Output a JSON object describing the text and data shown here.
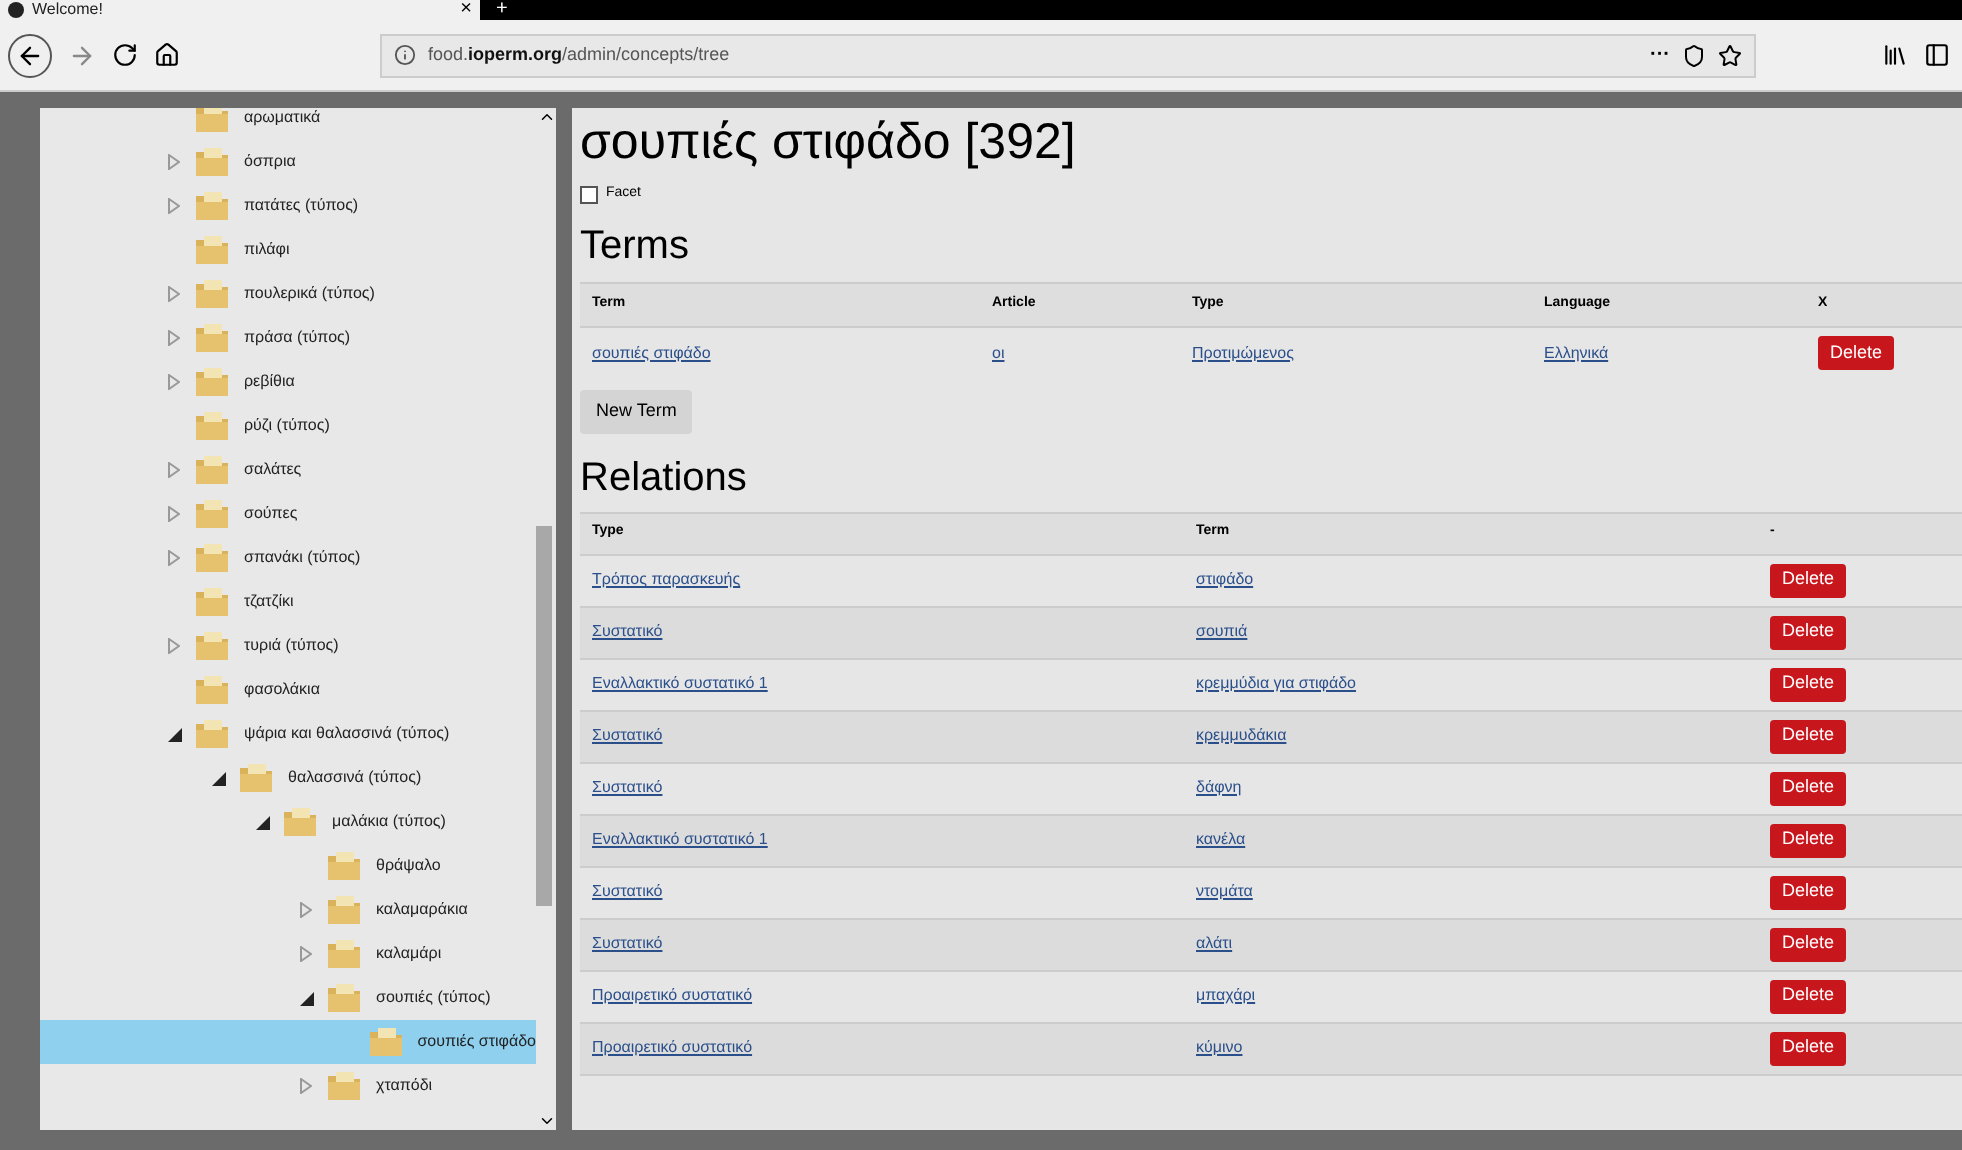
{
  "browser": {
    "tab_title": "Welcome!",
    "tab_close": "×",
    "new_tab": "+",
    "url_prefix": "food.",
    "url_domain": "ioperm.org",
    "url_path": "/admin/concepts/tree",
    "page_actions": "···"
  },
  "tree": [
    {
      "label": "αρωματικά",
      "kind": "leaf",
      "selected": false
    },
    {
      "label": "όσπρια",
      "kind": "collapsed",
      "selected": false
    },
    {
      "label": "πατάτες (τύπος)",
      "kind": "collapsed",
      "selected": false
    },
    {
      "label": "πιλάφι",
      "kind": "leaf",
      "selected": false
    },
    {
      "label": "πουλερικά (τύπος)",
      "kind": "collapsed",
      "selected": false
    },
    {
      "label": "πράσα (τύπος)",
      "kind": "collapsed",
      "selected": false
    },
    {
      "label": "ρεβίθια",
      "kind": "collapsed",
      "selected": false
    },
    {
      "label": "ρύζι (τύπος)",
      "kind": "leaf",
      "selected": false
    },
    {
      "label": "σαλάτες",
      "kind": "collapsed",
      "selected": false
    },
    {
      "label": "σούπες",
      "kind": "collapsed",
      "selected": false
    },
    {
      "label": "σπανάκι (τύπος)",
      "kind": "collapsed",
      "selected": false
    },
    {
      "label": "τζατζίκι",
      "kind": "leaf",
      "selected": false
    },
    {
      "label": "τυριά (τύπος)",
      "kind": "collapsed",
      "selected": false
    },
    {
      "label": "φασολάκια",
      "kind": "leaf",
      "selected": false
    },
    {
      "label": "ψάρια και θαλασσινά (τύπος)",
      "kind": "expanded",
      "selected": false,
      "children": [
        {
          "label": "θαλασσινά (τύπος)",
          "kind": "expanded",
          "selected": false,
          "children": [
            {
              "label": "μαλάκια (τύπος)",
              "kind": "expanded",
              "selected": false,
              "children": [
                {
                  "label": "θράψαλο",
                  "kind": "leaf",
                  "selected": false
                },
                {
                  "label": "καλαμαράκια",
                  "kind": "collapsed",
                  "selected": false
                },
                {
                  "label": "καλαμάρι",
                  "kind": "collapsed",
                  "selected": false
                },
                {
                  "label": "σουπιές (τύπος)",
                  "kind": "expanded",
                  "selected": false,
                  "children": [
                    {
                      "label": "σουπιές στιφάδο",
                      "kind": "leaf",
                      "selected": true
                    }
                  ]
                },
                {
                  "label": "χταπόδι",
                  "kind": "collapsed",
                  "selected": false
                }
              ]
            }
          ]
        }
      ]
    }
  ],
  "concept": {
    "title": "σουπιές στιφάδο [392]",
    "facet": {
      "label": "Facet",
      "checked": false
    }
  },
  "terms": {
    "heading": "Terms",
    "columns": [
      "Term",
      "Article",
      "Type",
      "Language",
      "X"
    ],
    "rows": [
      {
        "term": "σουπιές στιφάδο",
        "article": "οι",
        "type": "Προτιμώμενος",
        "language": "Ελληνικά",
        "action": "Delete"
      }
    ],
    "new_button": "New Term"
  },
  "relations": {
    "heading": "Relations",
    "columns": [
      "Type",
      "Term",
      "-"
    ],
    "rows": [
      {
        "type": "Τρόπος παρασκευής",
        "term": "στιφάδο",
        "action": "Delete"
      },
      {
        "type": "Συστατικό",
        "term": "σουπιά",
        "action": "Delete"
      },
      {
        "type": "Εναλλακτικό συστατικό 1",
        "term": "κρεμμύδια για στιφάδο",
        "action": "Delete"
      },
      {
        "type": "Συστατικό",
        "term": "κρεμμυδάκια",
        "action": "Delete"
      },
      {
        "type": "Συστατικό",
        "term": "δάφνη",
        "action": "Delete"
      },
      {
        "type": "Εναλλακτικό συστατικό 1",
        "term": "κανέλα",
        "action": "Delete"
      },
      {
        "type": "Συστατικό",
        "term": "ντομάτα",
        "action": "Delete"
      },
      {
        "type": "Συστατικό",
        "term": "αλάτι",
        "action": "Delete"
      },
      {
        "type": "Προαιρετικό συστατικό",
        "term": "μπαχάρι",
        "action": "Delete"
      },
      {
        "type": "Προαιρετικό συστατικό",
        "term": "κύμινο",
        "action": "Delete"
      }
    ]
  }
}
